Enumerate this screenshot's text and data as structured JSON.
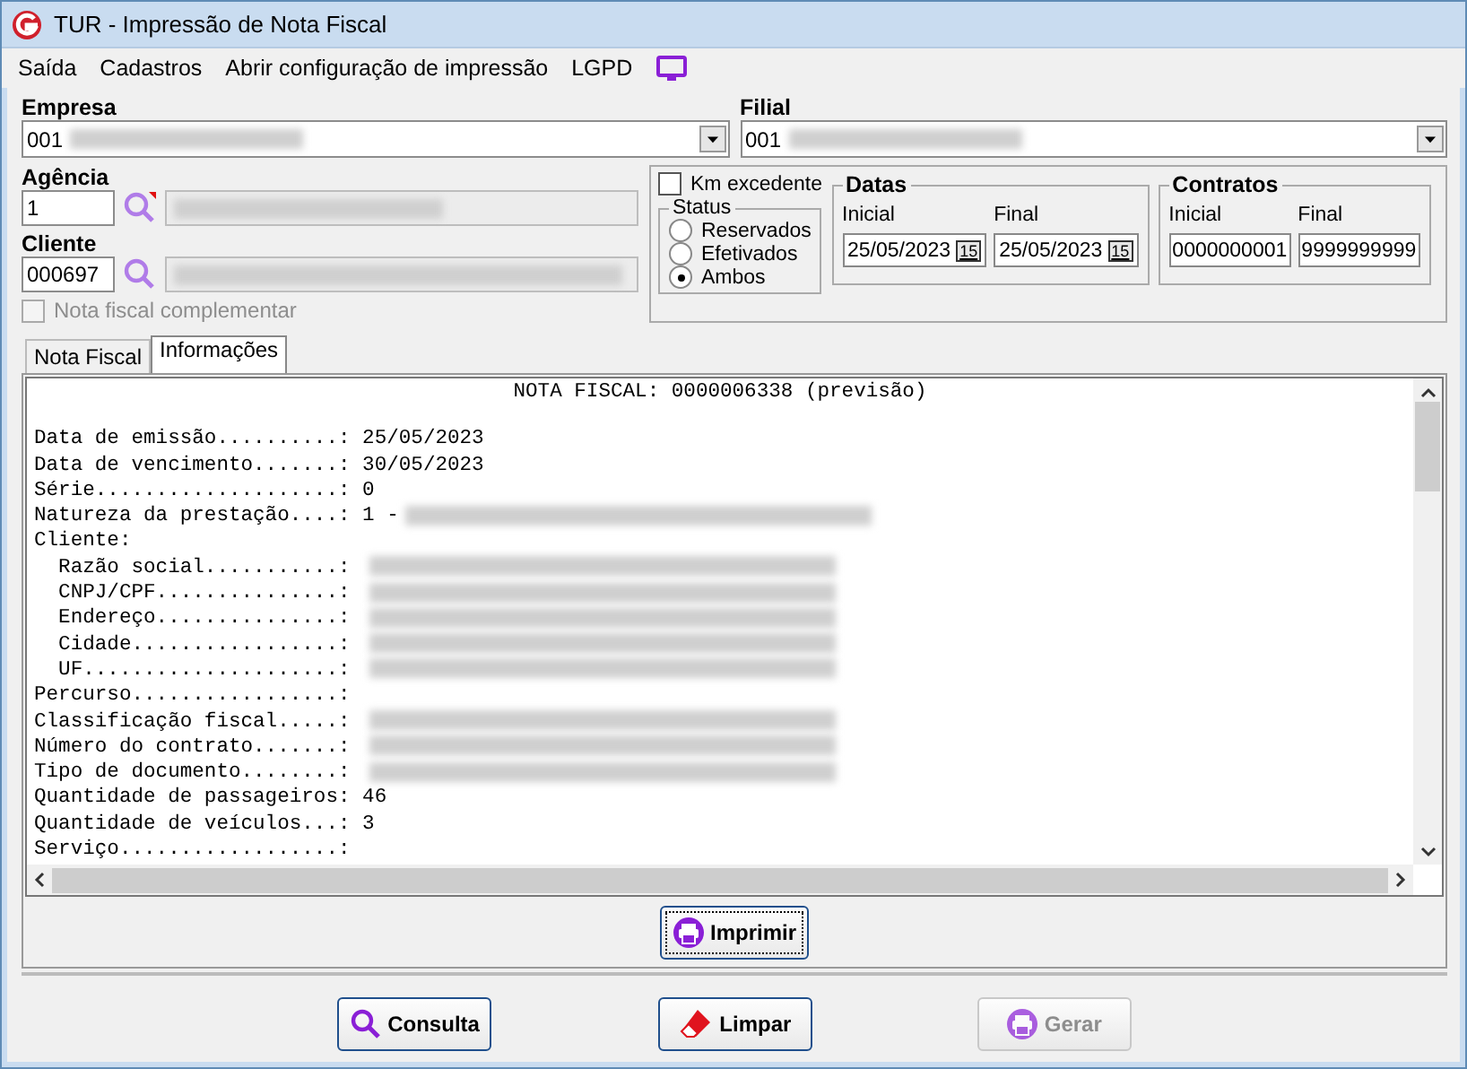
{
  "window": {
    "title": "TUR - Impressão de Nota Fiscal"
  },
  "menu": [
    "Saída",
    "Cadastros",
    "Abrir configuração de impressão",
    "LGPD"
  ],
  "empresa": {
    "label": "Empresa",
    "value": "001"
  },
  "filial": {
    "label": "Filial",
    "value": "001"
  },
  "agencia": {
    "label": "Agência",
    "value": "1"
  },
  "cliente": {
    "label": "Cliente",
    "value": "000697"
  },
  "nota_complementar": {
    "label": "Nota fiscal complementar",
    "checked": false,
    "disabled": true
  },
  "km_excedente": {
    "label": "Km excedente",
    "checked": false
  },
  "status": {
    "title": "Status",
    "options": [
      {
        "label": "Reservados",
        "selected": false
      },
      {
        "label": "Efetivados",
        "selected": false
      },
      {
        "label": "Ambos",
        "selected": true
      }
    ]
  },
  "datas": {
    "title": "Datas",
    "inicial_label": "Inicial",
    "inicial": "25/05/2023",
    "final_label": "Final",
    "final": "25/05/2023",
    "inicial_calendar": "15",
    "final_calendar": "15"
  },
  "contratos": {
    "title": "Contratos",
    "inicial_label": "Inicial",
    "inicial": "0000000001",
    "final_label": "Final",
    "final": "9999999999"
  },
  "tabs": [
    {
      "label": "Nota Fiscal",
      "selected": false
    },
    {
      "label": "Informações",
      "selected": true
    }
  ],
  "report": {
    "title": "NOTA FISCAL: 0000006338 (previsão)",
    "lines": [
      {
        "kind": "plain",
        "label": "Data de emissão..........: ",
        "value": "25/05/2023"
      },
      {
        "kind": "plain",
        "label": "Data de vencimento.......: ",
        "value": "30/05/2023"
      },
      {
        "kind": "plain",
        "label": "Série....................: ",
        "value": "0"
      },
      {
        "kind": "redacted",
        "label": "Natureza da prestação....: ",
        "value": "1 -"
      },
      {
        "kind": "plain",
        "label": "Cliente:"
      },
      {
        "kind": "redacted",
        "label": "  Razão social...........: "
      },
      {
        "kind": "redacted",
        "label": "  CNPJ/CPF...............: "
      },
      {
        "kind": "redacted",
        "label": "  Endereço...............: "
      },
      {
        "kind": "redacted",
        "label": "  Cidade.................: "
      },
      {
        "kind": "redacted",
        "label": "  UF.....................: "
      },
      {
        "kind": "plain",
        "label": "Percurso.................: "
      },
      {
        "kind": "redacted",
        "label": "Classificação fiscal.....: "
      },
      {
        "kind": "redacted",
        "label": "Número do contrato.......: "
      },
      {
        "kind": "redacted",
        "label": "Tipo de documento........: "
      },
      {
        "kind": "plain",
        "label": "Quantidade de passageiros: ",
        "value": "46"
      },
      {
        "kind": "plain",
        "label": "Quantidade de veículos...: ",
        "value": "3"
      },
      {
        "kind": "plain",
        "label": "Serviço..................: "
      }
    ]
  },
  "print_button": {
    "label": "Imprimir"
  },
  "buttons": [
    {
      "label": "Consulta",
      "disabled": false
    },
    {
      "label": "Limpar",
      "disabled": false
    },
    {
      "label": "Gerar",
      "disabled": true
    }
  ]
}
